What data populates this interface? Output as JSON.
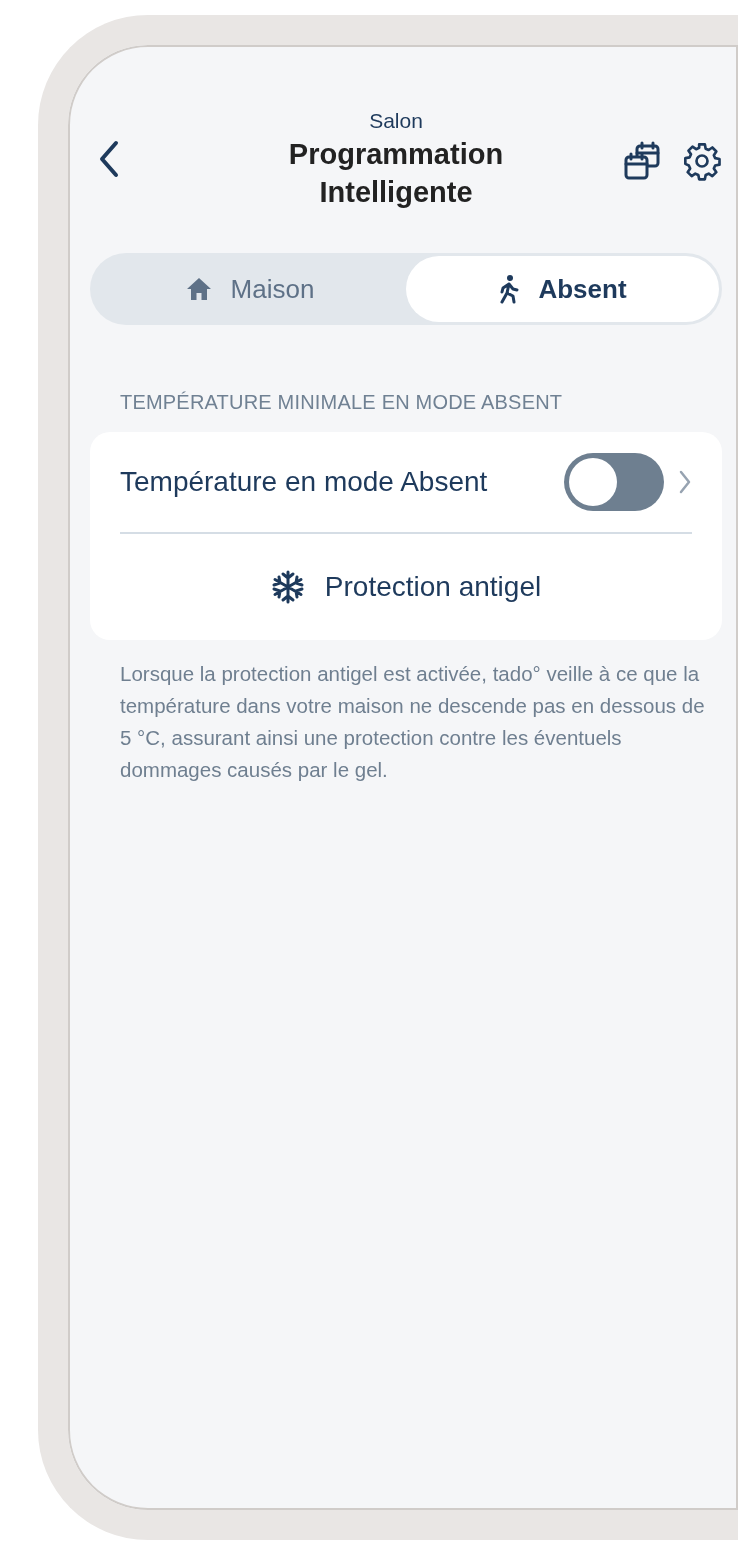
{
  "header": {
    "subtitle": "Salon",
    "title": "Programmation Intelligente"
  },
  "tabs": [
    {
      "label": "Maison",
      "kind": "home",
      "selected": false
    },
    {
      "label": "Absent",
      "kind": "away",
      "selected": true
    }
  ],
  "section": {
    "heading": "TEMPÉRATURE MINIMALE EN MODE ABSENT",
    "toggle_row": {
      "label": "Température en mode Absent",
      "on": false
    },
    "option": {
      "label": "Protection antigel"
    },
    "description": "Lorsque la protection antigel est activée, tado° veille à ce que la température dans votre maison ne descende pas en dessous de 5 °C, assurant ainsi une protection contre les éventuels dommages causés par le gel."
  }
}
